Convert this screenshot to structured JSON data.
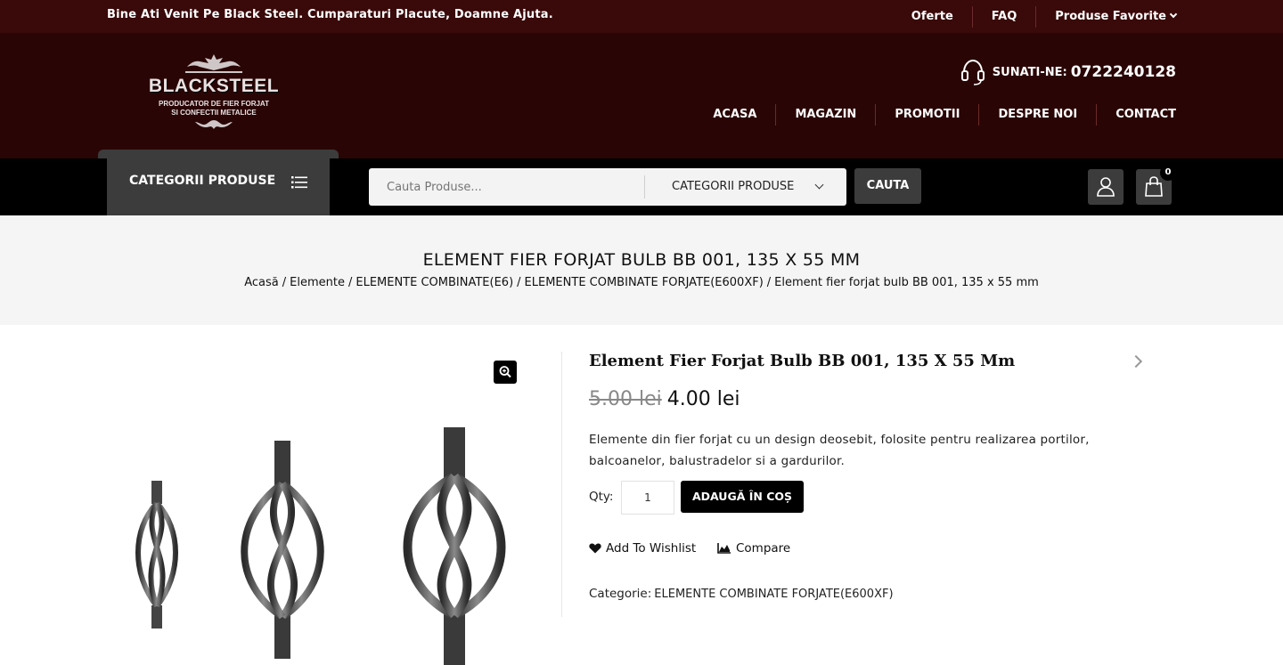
{
  "topbar": {
    "welcome": "Bine Ati Venit Pe Black Steel. Cumparaturi Placute, Doamne Ajuta.",
    "links": [
      "Oferte",
      "FAQ",
      "Produse Favorite"
    ]
  },
  "logo": {
    "brand": "BLACKSTEEL",
    "tagline1": "PRODUCATOR DE FIER FORJAT",
    "tagline2": "SI CONFECTII METALICE"
  },
  "contact": {
    "label": "SUNATI-NE:",
    "phone": "0722240128"
  },
  "nav": [
    "ACASA",
    "MAGAZIN",
    "PROMOTII",
    "DESPRE NOI",
    "CONTACT"
  ],
  "navbar": {
    "categories_label": "CATEGORII PRODUSE",
    "search_placeholder": "Cauta Produse...",
    "search_category": "CATEGORII PRODUSE",
    "search_button": "CAUTA",
    "cart_count": "0"
  },
  "page": {
    "title": "ELEMENT FIER FORJAT BULB BB 001, 135 X 55 MM",
    "breadcrumb": [
      "Acasă",
      "Elemente",
      "ELEMENTE COMBINATE(E6)",
      "ELEMENTE COMBINATE FORJATE(E600XF)",
      "Element fier forjat bulb BB 001, 135 x 55 mm"
    ]
  },
  "product": {
    "name": "Element Fier Forjat Bulb BB 001, 135 X 55 Mm",
    "old_price": "5.00 lei",
    "price": "4.00 lei",
    "description": "Elemente din fier forjat cu un design deosebit, folosite pentru realizarea portilor, balcoanelor, balustradelor si a gardurilor.",
    "qty_label": "Qty:",
    "qty_value": "1",
    "add_to_cart": "ADAUGĂ ÎN COȘ",
    "wishlist": "Add To Wishlist",
    "compare": "Compare",
    "category_label": "Categorie:",
    "category_value": "ELEMENTE COMBINATE FORJATE(E600XF)"
  },
  "colors": {
    "topbar": "#3a0909",
    "header": "#2a0505",
    "navbar": "#000000",
    "button": "#3c3c3c"
  }
}
